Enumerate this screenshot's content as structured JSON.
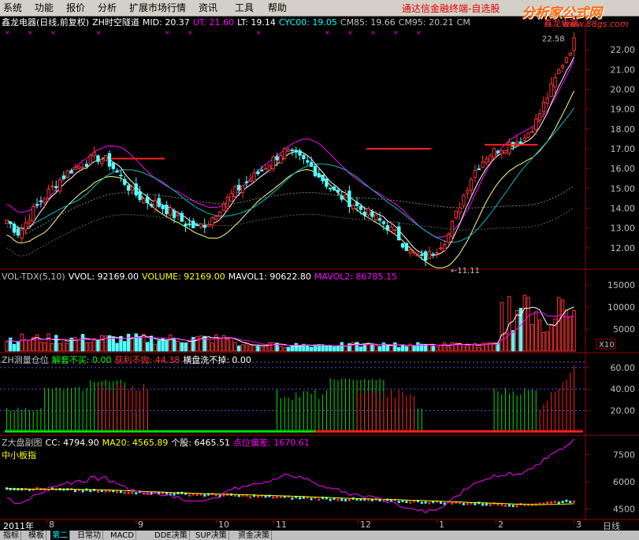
{
  "menu": [
    "系统",
    "功能",
    "报价",
    "分析",
    "扩展市场行情",
    "资讯",
    "工具",
    "帮助"
  ],
  "promo_text": "通达信金融终端-自选股",
  "watermark": {
    "text": "分析家公式网",
    "url": "www.88gs.com"
  },
  "stock_name": "鑫龙电器",
  "main_panel": {
    "title": "鑫龙电器(日线,前复权)",
    "indicator": "ZH时空隧道",
    "values": [
      {
        "label": "MID: 20.37",
        "color": "#ffffff"
      },
      {
        "label": "UT: 21.60",
        "color": "#ff00ff"
      },
      {
        "label": "LT: 19.14",
        "color": "#ffffff"
      },
      {
        "label": "CYC00: 19.05",
        "color": "#00ffff"
      },
      {
        "label": "CM85: 19.66",
        "color": "#c0c0c0"
      },
      {
        "label": "CM95: 20.21",
        "color": "#c0c0c0"
      },
      {
        "label": "CM",
        "color": "#c0c0c0"
      }
    ],
    "high_label": "22.58",
    "low_label": "11.11",
    "y_ticks": [
      "22.00",
      "21.00",
      "20.00",
      "19.00",
      "18.00",
      "17.00",
      "16.00",
      "15.00",
      "14.00",
      "13.00",
      "12.00"
    ]
  },
  "vol_panel": {
    "values": [
      {
        "label": "VOL-TDX(5,10)",
        "color": "#c0c0c0"
      },
      {
        "label": "VVOL: 92169.00",
        "color": "#ffffff"
      },
      {
        "label": "VOLUME: 92169.00",
        "color": "#ffff00"
      },
      {
        "label": "MAVOL1: 90622.80",
        "color": "#ffffff"
      },
      {
        "label": "MAVOL2: 86785.15",
        "color": "#ff00ff"
      }
    ],
    "y_ticks": [
      "15000",
      "10000",
      "5000"
    ],
    "unit": "X10"
  },
  "pos_panel": {
    "values": [
      {
        "label": "ZH测量仓位",
        "color": "#c0c0c0"
      },
      {
        "label": "解套不买: 0.00",
        "color": "#00ff00"
      },
      {
        "label": "获利不抛: 44.38",
        "color": "#ff3333"
      },
      {
        "label": "横盘洗不掉: 0.00",
        "color": "#ffffff"
      }
    ],
    "y_ticks": [
      "60.00",
      "40.00",
      "20.00"
    ]
  },
  "board_panel": {
    "values": [
      {
        "label": "Z大盘副图",
        "color": "#c0c0c0"
      },
      {
        "label": "CC: 4794.90",
        "color": "#ffffff"
      },
      {
        "label": "MA20: 4565.89",
        "color": "#ffff00"
      },
      {
        "label": "个股: 6465.51",
        "color": "#ffffff"
      },
      {
        "label": "点位偏差: 1670.61",
        "color": "#ff00ff"
      }
    ],
    "sub_label": "中小板指",
    "y_ticks": [
      "7500",
      "6000",
      "4500"
    ]
  },
  "date_axis": {
    "labels": [
      "2011年",
      "8",
      "9",
      "10",
      "11",
      "12",
      "1",
      "2",
      "3"
    ],
    "right_label": "日线"
  },
  "tabs": [
    "指标",
    "模板",
    "第二",
    "日常功",
    "MACD",
    "DDE决策",
    "SUP决策",
    "资金决策"
  ],
  "active_tab": 2,
  "chart_data": [
    {
      "type": "candlestick",
      "title": "鑫龙电器(日线,前复权)",
      "ylim": [
        11.0,
        22.6
      ],
      "x_labels": [
        "2011年",
        "8",
        "9",
        "10",
        "11",
        "12",
        "1",
        "2",
        "3"
      ],
      "close_path": [
        13.4,
        12.7,
        13.8,
        14.6,
        15.3,
        15.9,
        16.2,
        16.6,
        16.4,
        15.6,
        14.8,
        14.4,
        14.2,
        13.8,
        13.3,
        13.0,
        13.3,
        14.1,
        14.8,
        15.3,
        15.8,
        16.4,
        16.9,
        16.6,
        16.2,
        15.5,
        14.8,
        14.4,
        14.0,
        13.6,
        13.2,
        12.6,
        11.8,
        11.4,
        11.9,
        12.6,
        14.3,
        15.8,
        16.6,
        17.0,
        17.3,
        17.5,
        18.4,
        19.8,
        21.2,
        22.4
      ],
      "low_extreme": 11.11,
      "high_extreme": 22.58
    },
    {
      "type": "bar",
      "title": "VOL-TDX(5,10)",
      "ylim": [
        0,
        15000
      ],
      "last_value": 9216.9
    },
    {
      "type": "bar",
      "title": "ZH测量仓位",
      "ylim": [
        0,
        60
      ],
      "series": [
        {
          "name": "获利不抛",
          "last_value": 44.38
        }
      ]
    },
    {
      "type": "line",
      "title": "Z大盘副图",
      "ylim": [
        4000,
        8000
      ],
      "series": [
        {
          "name": "CC",
          "last_value": 4794.9
        },
        {
          "name": "MA20",
          "last_value": 4565.89
        },
        {
          "name": "个股",
          "last_value": 6465.51
        }
      ]
    }
  ]
}
